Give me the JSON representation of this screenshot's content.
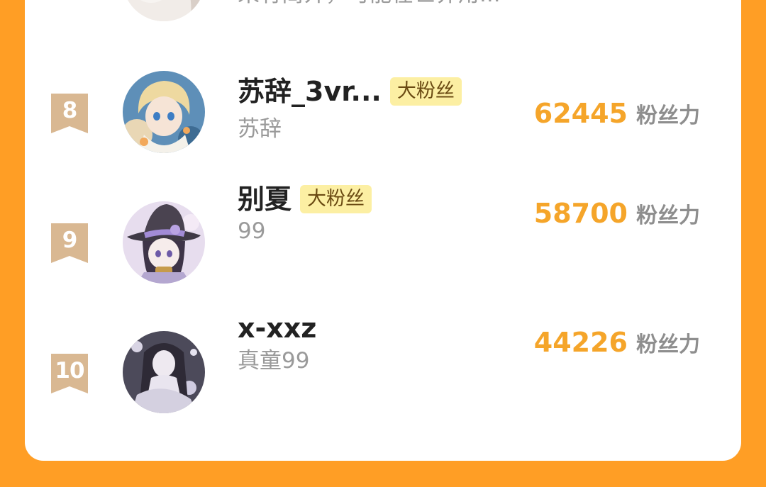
{
  "previous_row": {
    "subtext": "来有简介，可能在世界角..."
  },
  "ranking": [
    {
      "rank": "8",
      "name": "苏辞_3vr...",
      "tag": "大粉丝",
      "subtext": "苏辞",
      "score": "62445",
      "unit": "粉丝力",
      "avatar_icon": "anime-avatar-blonde-icon"
    },
    {
      "rank": "9",
      "name": "别夏",
      "tag": "大粉丝",
      "subtext": "99",
      "score": "58700",
      "unit": "粉丝力",
      "avatar_icon": "anime-avatar-witch-hat-icon"
    },
    {
      "rank": "10",
      "name": "x-xxz",
      "tag": "",
      "subtext": "真童99",
      "score": "44226",
      "unit": "粉丝力",
      "avatar_icon": "anime-avatar-dark-hair-icon"
    }
  ],
  "colors": {
    "page_bg": "#FF9E25",
    "card_bg": "#FFFFFF",
    "badge": "#D9B892",
    "score": "#F5A52A",
    "tag_bg": "#FCEFA3"
  }
}
